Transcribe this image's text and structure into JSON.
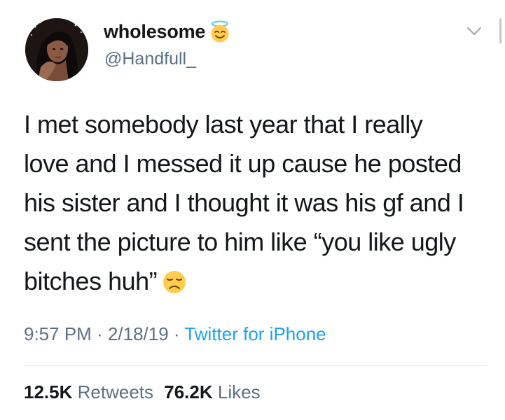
{
  "author": {
    "display_name": "wholesome",
    "name_emoji": "smiling-face-with-halo-icon",
    "handle": "@Handfull_"
  },
  "tweet": {
    "lines": [
      "I met somebody last year that I really",
      "love and I messed it up cause he posted",
      "his sister and I thought it was his gf and I",
      "sent the picture to him like “you like ugly",
      "bitches huh”"
    ],
    "trailing_emoji": "disappointed-face-icon"
  },
  "meta": {
    "time": "9:57 PM",
    "date": "2/18/19",
    "separator": " · ",
    "source": "Twitter for iPhone"
  },
  "stats": {
    "retweets_count": "12.5K",
    "retweets_label": "Retweets",
    "likes_count": "76.2K",
    "likes_label": "Likes"
  },
  "colors": {
    "text": "#14171a",
    "secondary": "#5b7083",
    "link": "#1da1f2",
    "divider": "#e1e8ed"
  }
}
